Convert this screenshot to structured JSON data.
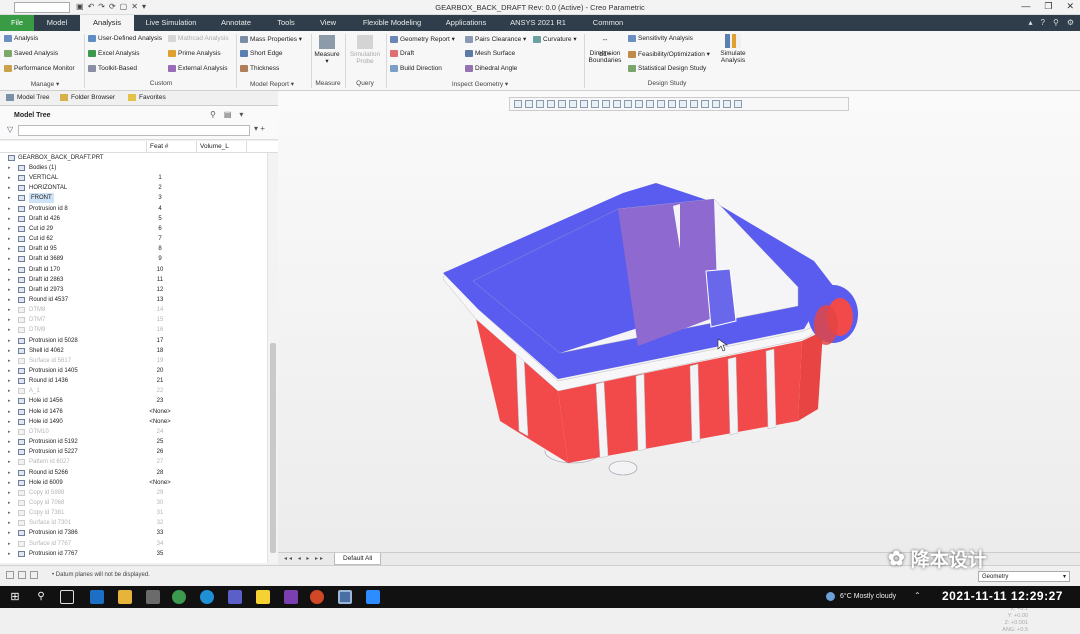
{
  "window": {
    "title": "GEARBOX_BACK_DRAFT Rev: 0.0 (Active) - Creo Parametric",
    "controls": [
      "—",
      "❐",
      "✕"
    ]
  },
  "menu_tabs": [
    "File",
    "Model",
    "Analysis",
    "Live Simulation",
    "Annotate",
    "Tools",
    "View",
    "Flexible Modeling",
    "Applications",
    "ANSYS 2021 R1",
    "Common"
  ],
  "active_tab": "Analysis",
  "ribbon": {
    "manage": {
      "items": [
        "Analysis",
        "Saved Analysis",
        "Performance Monitor"
      ],
      "group": "Manage ▾"
    },
    "custom": {
      "items": [
        "User-Defined Analysis",
        "Excel Analysis",
        "Toolkit-Based",
        "Mathcad Analysis",
        "Prime Analysis",
        "External Analysis"
      ],
      "group": "Custom"
    },
    "model_report": {
      "items": [
        "Mass Properties ▾",
        "Short Edge",
        "Thickness"
      ],
      "group": "Model Report ▾"
    },
    "measure": {
      "label": "Measure",
      "group": "Measure"
    },
    "query": {
      "label": "Simulation Probe",
      "group": "Query"
    },
    "inspect": {
      "items": [
        "Geometry Report ▾",
        "Draft",
        "Build Direction",
        "Pairs Clearance ▾",
        "Mesh Surface",
        "Dihedral Angle",
        "Curvature ▾"
      ],
      "group": "Inspect Geometry ▾"
    },
    "design_study": {
      "items": [
        "Dimension Boundaries",
        "Sensitivity Analysis",
        "Feasibility/Optimization ▾",
        "Statistical Design Study",
        "Simulate Analysis"
      ],
      "group": "Design Study"
    },
    "dim_icon": "--d1+"
  },
  "left_tabs": [
    "Model Tree",
    "Folder Browser",
    "Favorites"
  ],
  "tree": {
    "title": "Model Tree",
    "columns": [
      "Feat #",
      "Volume_L"
    ],
    "root": "GEARBOX_BACK_DRAFT.PRT",
    "rows": [
      {
        "name": "Bodies (1)",
        "feat": ""
      },
      {
        "name": "VERTICAL",
        "feat": "1"
      },
      {
        "name": "HORIZONTAL",
        "feat": "2"
      },
      {
        "name": "FRONT",
        "feat": "3"
      },
      {
        "name": "Protrusion id 8",
        "feat": "4"
      },
      {
        "name": "Draft id 426",
        "feat": "5"
      },
      {
        "name": "Cut id 29",
        "feat": "6"
      },
      {
        "name": "Cut id 62",
        "feat": "7"
      },
      {
        "name": "Draft id 95",
        "feat": "8"
      },
      {
        "name": "Draft id 3689",
        "feat": "9"
      },
      {
        "name": "Draft id 170",
        "feat": "10"
      },
      {
        "name": "Draft id 2863",
        "feat": "11"
      },
      {
        "name": "Draft id 2973",
        "feat": "12"
      },
      {
        "name": "Round id 4537",
        "feat": "13"
      },
      {
        "name": "DTM8",
        "feat": "14"
      },
      {
        "name": "DTM7",
        "feat": "15"
      },
      {
        "name": "DTM9",
        "feat": "16"
      },
      {
        "name": "Protrusion id 5028",
        "feat": "17"
      },
      {
        "name": "Shell id 4062",
        "feat": "18"
      },
      {
        "name": "Surface id 5617",
        "feat": "19"
      },
      {
        "name": "Protrusion id 1405",
        "feat": "20"
      },
      {
        "name": "Round id 1436",
        "feat": "21"
      },
      {
        "name": "A_1",
        "feat": "22"
      },
      {
        "name": "Hole id 1456",
        "feat": "23"
      },
      {
        "name": "Hole id 1476",
        "feat": "<None>"
      },
      {
        "name": "Hole id 1490",
        "feat": "<None>"
      },
      {
        "name": "DTM10",
        "feat": "24"
      },
      {
        "name": "Protrusion id 5192",
        "feat": "25"
      },
      {
        "name": "Protrusion id 5227",
        "feat": "26"
      },
      {
        "name": "Pattern id 6027",
        "feat": "27"
      },
      {
        "name": "Round id 5266",
        "feat": "28"
      },
      {
        "name": "Hole id 6009",
        "feat": "<None>"
      },
      {
        "name": "Copy id 5998",
        "feat": "29"
      },
      {
        "name": "Copy id 7068",
        "feat": "30"
      },
      {
        "name": "Copy id 7381",
        "feat": "31"
      },
      {
        "name": "Surface id 7301",
        "feat": "32"
      },
      {
        "name": "Protrusion id 7386",
        "feat": "33"
      },
      {
        "name": "Surface id 7767",
        "feat": "34"
      },
      {
        "name": "Protrusion id 7767",
        "feat": "35"
      }
    ],
    "dim_rows": [
      14,
      15,
      16,
      19,
      22,
      26,
      29,
      32,
      33,
      34,
      35,
      37
    ],
    "highlight_row": 3
  },
  "graphics": {
    "coords": [
      "X: +0.1",
      "Y: +0.00",
      "Z: +0.001",
      "ANG: +0.5"
    ]
  },
  "bottom_tab": "Default All",
  "status": {
    "message": "• Datum planes will not be displayed.",
    "filter": "Geometry"
  },
  "watermark": "降本设计",
  "taskbar": {
    "weather": "6°C  Mostly cloudy",
    "clock": "2021-11-11  12:29:27"
  },
  "colors": {
    "draft_positive": "#5a5cf0",
    "draft_negative": "#f24a4a",
    "neutral_face": "#f4f4f6",
    "file_tab": "#3a9b45",
    "tab_bar": "#2f3e4a"
  }
}
